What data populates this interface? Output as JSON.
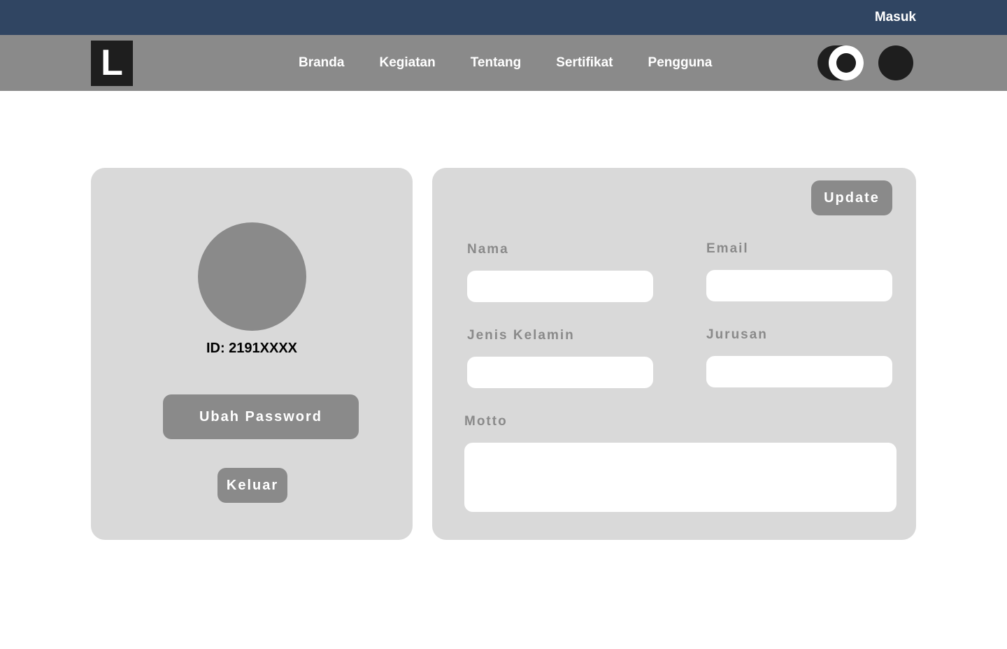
{
  "topbar": {
    "login_label": "Masuk",
    "background": "#304562"
  },
  "navbar": {
    "logo_letter": "L",
    "links": [
      "Branda",
      "Kegiatan",
      "Tentang",
      "Sertifikat",
      "Pengguna"
    ],
    "toggle_icon": "theme-toggle-icon",
    "user_icon": "user-circle-icon",
    "background": "#8a8a8a"
  },
  "profile": {
    "avatar_icon": "avatar-placeholder",
    "id_text": "ID: 2191XXXX",
    "change_password_label": "Ubah Password",
    "logout_label": "Keluar"
  },
  "form": {
    "update_label": "Update",
    "fields": {
      "nama": {
        "label": "Nama",
        "value": ""
      },
      "email": {
        "label": "Email",
        "value": ""
      },
      "jenis_kelamin": {
        "label": "Jenis Kelamin",
        "value": ""
      },
      "jurusan": {
        "label": "Jurusan",
        "value": ""
      },
      "motto": {
        "label": "Motto",
        "value": ""
      }
    }
  },
  "colors": {
    "card_background": "#d9d9d9",
    "button_background": "#8a8a8a",
    "dark": "#1e1e1e"
  }
}
